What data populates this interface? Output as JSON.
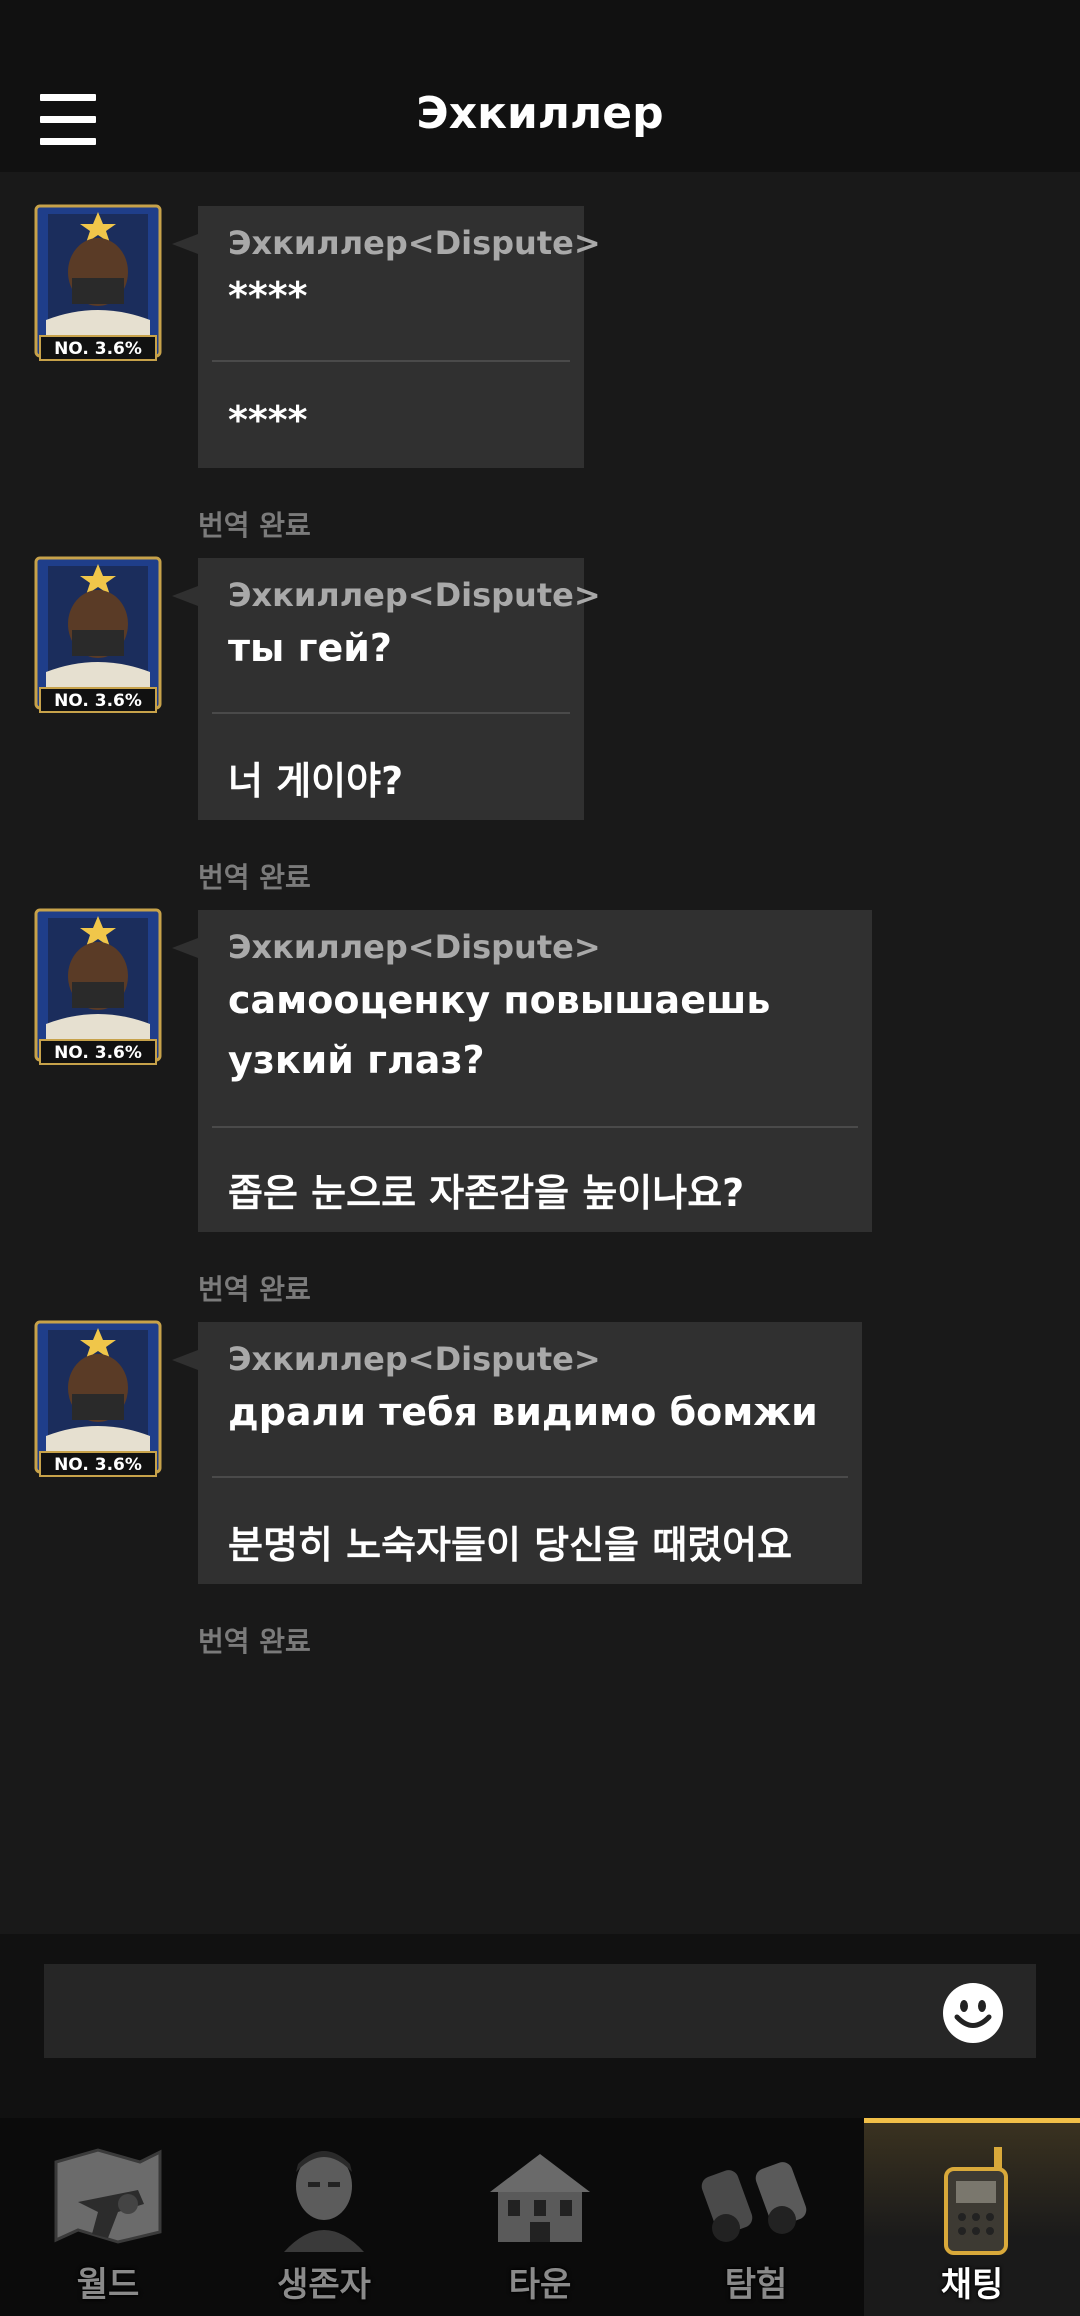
{
  "header": {
    "title": "Эхкиллер"
  },
  "avatar": {
    "badge": "NO. 3.6%"
  },
  "messages": [
    {
      "sender": "Эхкиллер<Dispute>",
      "original": "****",
      "translation": "****",
      "status": "번역 완료"
    },
    {
      "sender": "Эхкиллер<Dispute>",
      "original": "ты гей?",
      "translation": "너 게이야?",
      "status": "번역 완료"
    },
    {
      "sender": "Эхкиллер<Dispute>",
      "original_line1": "самооценку повышаешь",
      "original_line2": "узкий глаз?",
      "translation": "좁은 눈으로 자존감을 높이나요?",
      "status": "번역 완료"
    },
    {
      "sender": "Эхкиллер<Dispute>",
      "original": "драли тебя видимо бомжи",
      "translation": "분명히 노숙자들이 당신을 때렸어요",
      "status": "번역 완료"
    }
  ],
  "input": {
    "placeholder": ""
  },
  "tabs": [
    {
      "label": "월드",
      "icon": "map-revolver-icon"
    },
    {
      "label": "생존자",
      "icon": "survivor-icon"
    },
    {
      "label": "타운",
      "icon": "town-icon"
    },
    {
      "label": "탐험",
      "icon": "binoculars-icon"
    },
    {
      "label": "채팅",
      "icon": "walkie-talkie-icon",
      "active": true
    }
  ],
  "colors": {
    "accent": "#f2c048",
    "bubble": "#303030",
    "background": "#191919"
  }
}
